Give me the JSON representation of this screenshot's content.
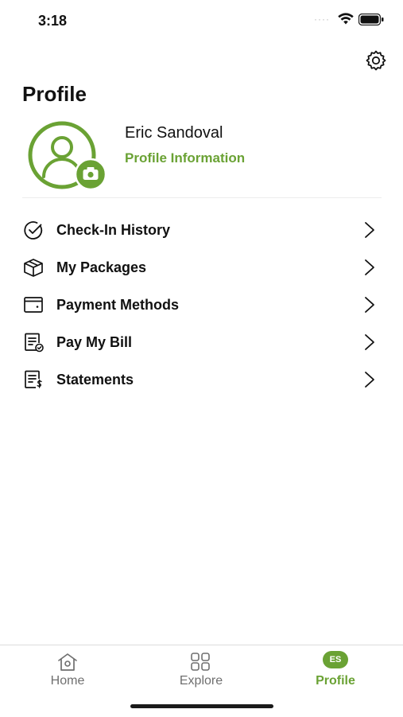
{
  "status_bar": {
    "time": "3:18",
    "signal": "····"
  },
  "header": {
    "title": "Profile",
    "settings_icon": "gear-icon"
  },
  "user": {
    "name": "Eric Sandoval",
    "profile_link": "Profile Information",
    "avatar_icon": "user-avatar-icon",
    "camera_icon": "camera-icon"
  },
  "menu": {
    "items": [
      {
        "label": "Check-In History",
        "icon": "check-circle-icon"
      },
      {
        "label": "My Packages",
        "icon": "package-icon"
      },
      {
        "label": "Payment Methods",
        "icon": "wallet-icon"
      },
      {
        "label": "Pay My Bill",
        "icon": "bill-check-icon"
      },
      {
        "label": "Statements",
        "icon": "statement-dollar-icon"
      }
    ]
  },
  "tabs": [
    {
      "label": "Home",
      "icon": "home-icon"
    },
    {
      "label": "Explore",
      "icon": "grid-icon"
    },
    {
      "label": "Profile",
      "badge": "ES",
      "active": true
    }
  ],
  "colors": {
    "accent": "#6aa234",
    "text": "#111111",
    "muted": "#6f6f6f"
  }
}
